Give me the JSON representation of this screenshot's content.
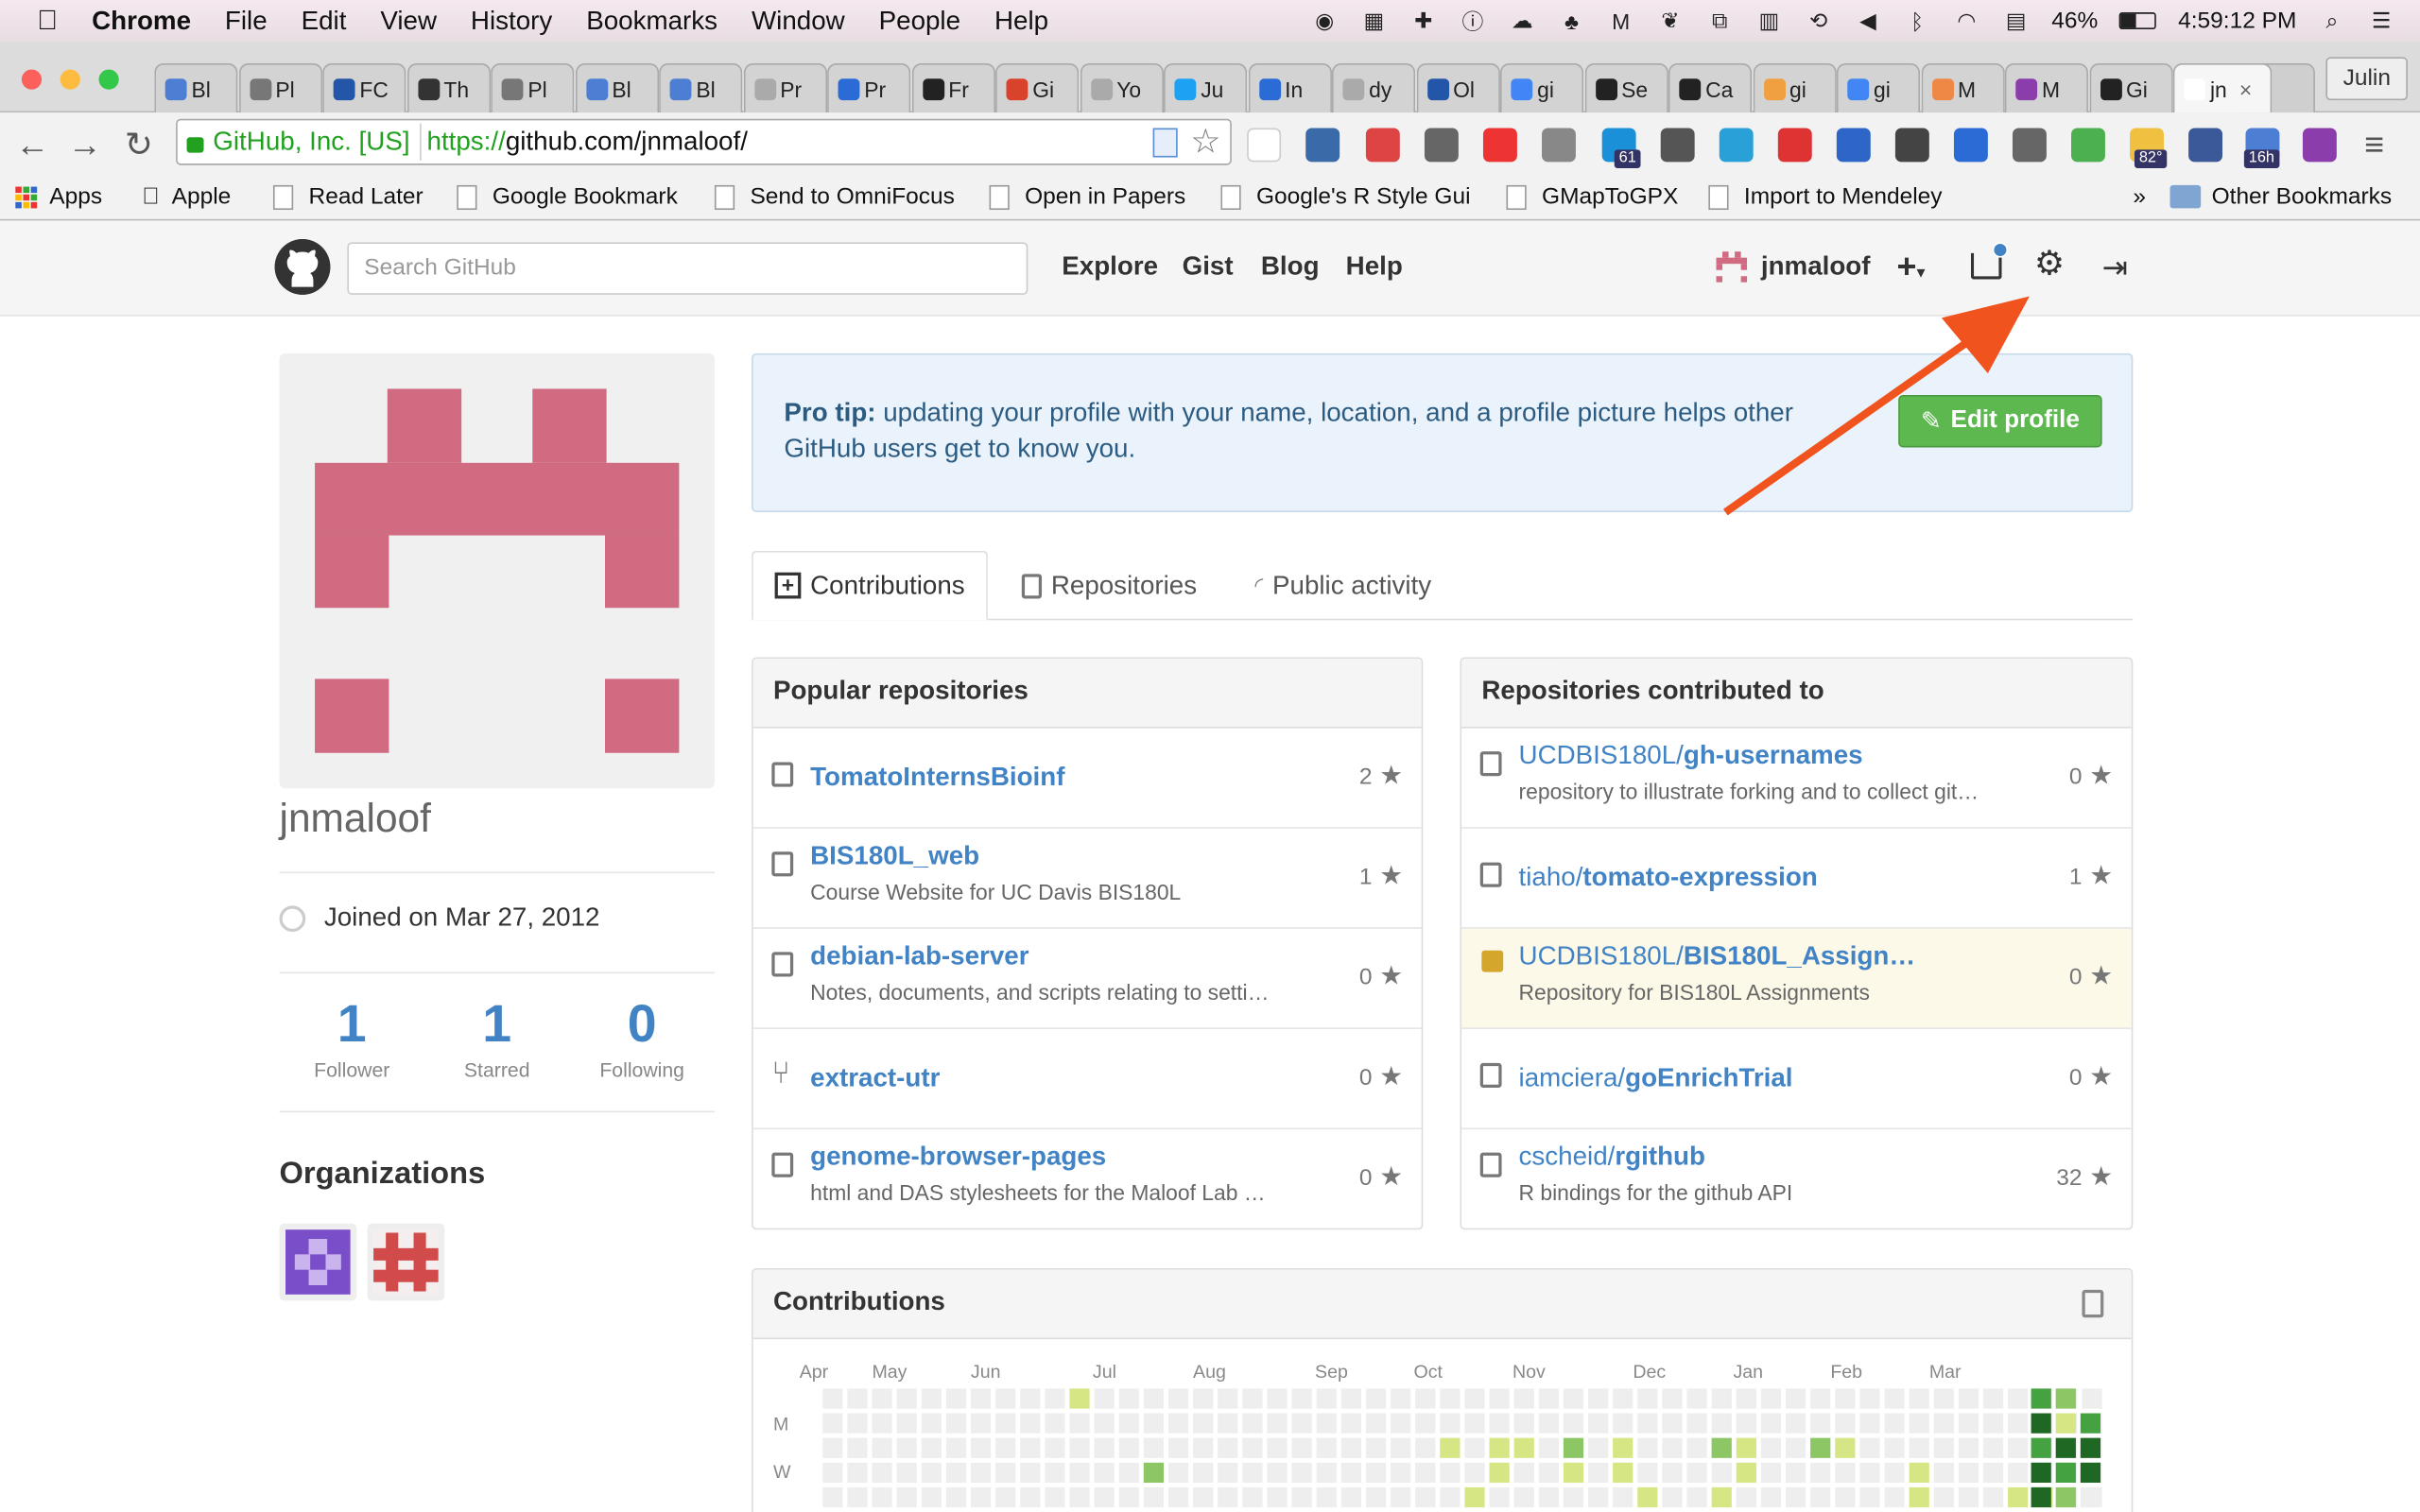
{
  "menubar": {
    "app": "Chrome",
    "items": [
      "File",
      "Edit",
      "View",
      "History",
      "Bookmarks",
      "Window",
      "People",
      "Help"
    ],
    "battery": "46%",
    "clock": "4:59:12 PM"
  },
  "tabs": [
    {
      "label": "Bl"
    },
    {
      "label": "Pl"
    },
    {
      "label": "FC"
    },
    {
      "label": "Th"
    },
    {
      "label": "Pl"
    },
    {
      "label": "Bl"
    },
    {
      "label": "Bl"
    },
    {
      "label": "Pr"
    },
    {
      "label": "Pr"
    },
    {
      "label": "Fr"
    },
    {
      "label": "Gi"
    },
    {
      "label": "Yo"
    },
    {
      "label": "Ju"
    },
    {
      "label": "In"
    },
    {
      "label": "dy"
    },
    {
      "label": "Ol"
    },
    {
      "label": "gi"
    },
    {
      "label": "Se"
    },
    {
      "label": "Ca"
    },
    {
      "label": "gi"
    },
    {
      "label": "gi"
    },
    {
      "label": "M"
    },
    {
      "label": "M"
    },
    {
      "label": "Gi"
    },
    {
      "label": "jn"
    }
  ],
  "profile_button": "Julin",
  "omnibox": {
    "ev_label": "GitHub, Inc. [US]",
    "url_scheme": "https://",
    "url_rest": "github.com/jnmaloof/"
  },
  "extensions": {
    "badge_61": "61",
    "badge_82": "82°",
    "badge_16h": "16h"
  },
  "bookmarks": {
    "items": [
      "Apps",
      "Apple",
      "Read Later",
      "Google Bookmark",
      "Send to OmniFocus",
      "Open in Papers",
      "Google's R Style Gui",
      "GMapToGPX",
      "Import to Mendeley"
    ],
    "overflow": "»",
    "other": "Other Bookmarks"
  },
  "github": {
    "search_placeholder": "Search GitHub",
    "nav": [
      "Explore",
      "Gist",
      "Blog",
      "Help"
    ],
    "username": "jnmaloof"
  },
  "sidebar": {
    "name": "jnmaloof",
    "joined": "Joined on Mar 27, 2012",
    "stats": [
      {
        "num": "1",
        "label": "Follower"
      },
      {
        "num": "1",
        "label": "Starred"
      },
      {
        "num": "0",
        "label": "Following"
      }
    ],
    "orgs_title": "Organizations"
  },
  "protip": {
    "lead": "Pro tip:",
    "text": " updating your profile with your name, location, and a profile picture helps other GitHub users get to know you.",
    "button": "Edit profile"
  },
  "profile_tabs": [
    "Contributions",
    "Repositories",
    "Public activity"
  ],
  "popular": {
    "title": "Popular repositories",
    "rows": [
      {
        "name": "TomatoInternsBioinf",
        "desc": "",
        "stars": "2"
      },
      {
        "name": "BIS180L_web",
        "desc": "Course Website for UC Davis BIS180L",
        "stars": "1"
      },
      {
        "name": "debian-lab-server",
        "desc": "Notes, documents, and scripts relating to setti…",
        "stars": "0"
      },
      {
        "name": "extract-utr",
        "desc": "",
        "stars": "0"
      },
      {
        "name": "genome-browser-pages",
        "desc": "html and DAS stylesheets for the Maloof Lab …",
        "stars": "0"
      }
    ]
  },
  "contributed": {
    "title": "Repositories contributed to",
    "rows": [
      {
        "owner": "UCDBIS180L/",
        "name": "gh-usernames",
        "desc": "repository to illustrate forking and to collect git…",
        "stars": "0"
      },
      {
        "owner": "tiaho/",
        "name": "tomato-expression",
        "desc": "",
        "stars": "1"
      },
      {
        "owner": "UCDBIS180L/",
        "name": "BIS180L_Assign…",
        "desc": "Repository for BIS180L Assignments",
        "stars": "0"
      },
      {
        "owner": "iamciera/",
        "name": "goEnrichTrial",
        "desc": "",
        "stars": "0"
      },
      {
        "owner": "cscheid/",
        "name": "rgithub",
        "desc": "R bindings for the github API",
        "stars": "32"
      }
    ]
  },
  "contributions": {
    "title": "Contributions",
    "months": [
      "Apr",
      "May",
      "Jun",
      "Jul",
      "Aug",
      "Sep",
      "Oct",
      "Nov",
      "Dec",
      "Jan",
      "Feb",
      "Mar"
    ],
    "days": [
      "M",
      "W"
    ]
  },
  "colors": {
    "accent": "#4183c4",
    "green": "#5cb84f",
    "arrow": "#f0531e",
    "identicon": "#d06b82"
  }
}
